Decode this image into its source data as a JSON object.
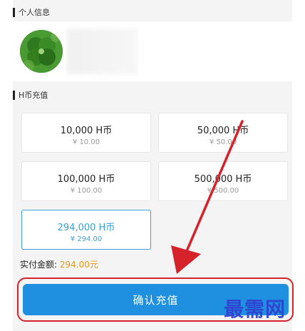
{
  "personal_info": {
    "section_title": "个人信息"
  },
  "recharge": {
    "section_title": "H币充值",
    "options": [
      {
        "amount": "10,000 H币",
        "price": "¥ 10.00",
        "selected": false
      },
      {
        "amount": "50,000 H币",
        "price": "¥ 50.00",
        "selected": false
      },
      {
        "amount": "100,000 H币",
        "price": "¥ 100.00",
        "selected": false
      },
      {
        "amount": "500,000 H币",
        "price": "¥ 500.00",
        "selected": false
      },
      {
        "amount": "294,000 H币",
        "price": "¥ 294.00",
        "selected": true
      }
    ]
  },
  "payment": {
    "label": "实付金额: ",
    "value": "294.00元"
  },
  "confirm_button": {
    "label": "确认充值"
  },
  "watermark": {
    "text": "最需网"
  },
  "colors": {
    "accent": "#1e90df",
    "selected": "#3aa0d8",
    "amount_highlight": "#e69a1a",
    "annotation_red": "#d6222a"
  }
}
